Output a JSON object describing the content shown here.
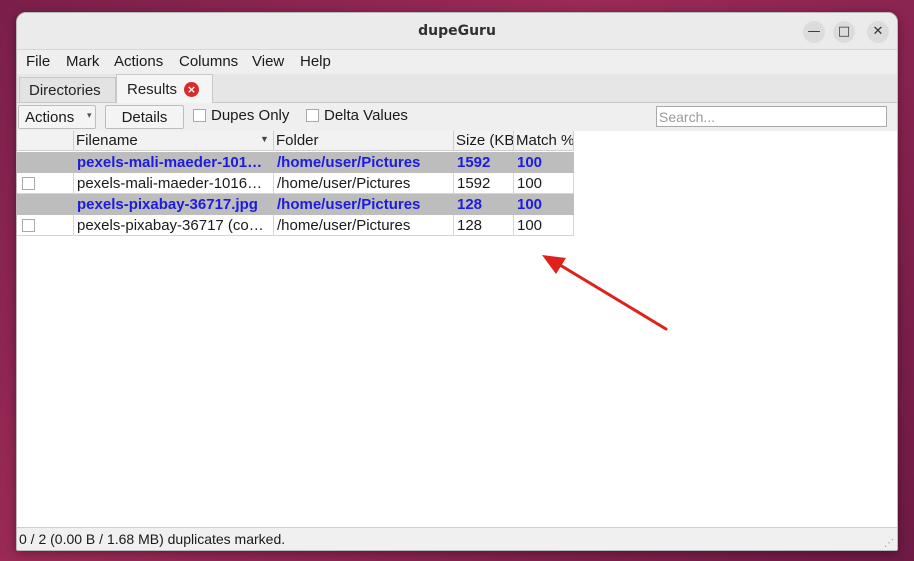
{
  "window": {
    "title": "dupeGuru",
    "controls": {
      "minimize": "—",
      "maximize": "□",
      "close": "✕"
    }
  },
  "menu": [
    "File",
    "Mark",
    "Actions",
    "Columns",
    "View",
    "Help"
  ],
  "tabs": [
    {
      "label": "Directories",
      "active": false
    },
    {
      "label": "Results",
      "active": true,
      "closable": true
    }
  ],
  "toolbar": {
    "actions_label": "Actions",
    "details_label": "Details",
    "dupes_only_label": "Dupes Only",
    "delta_values_label": "Delta Values",
    "search_placeholder": "Search..."
  },
  "table": {
    "columns": [
      "Filename",
      "Folder",
      "Size (KB)",
      "Match %"
    ],
    "rows": [
      {
        "type": "reference",
        "filename": "pexels-mali-maeder-101…",
        "folder": "/home/user/Pictures",
        "size": "1592",
        "match": "100"
      },
      {
        "type": "duplicate",
        "filename": "pexels-mali-maeder-1016…",
        "folder": "/home/user/Pictures",
        "size": "1592",
        "match": "100"
      },
      {
        "type": "reference",
        "filename": "pexels-pixabay-36717.jpg",
        "folder": "/home/user/Pictures",
        "size": "128",
        "match": "100"
      },
      {
        "type": "duplicate",
        "filename": "pexels-pixabay-36717 (co…",
        "folder": "/home/user/Pictures",
        "size": "128",
        "match": "100"
      }
    ]
  },
  "status": "0 / 2 (0.00 B / 1.68 MB) duplicates marked.",
  "colors": {
    "reference_text": "#1c1ce0",
    "reference_bg": "#bdbdbd",
    "annotation_arrow": "#e0201c"
  }
}
